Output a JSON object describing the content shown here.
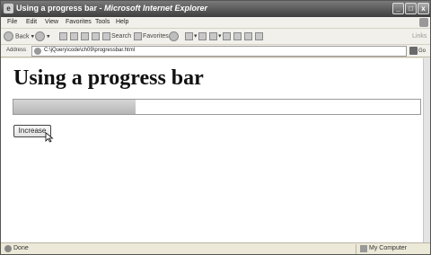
{
  "window": {
    "title_page": "Using a progress bar",
    "title_sep": " - ",
    "title_app": "Microsoft Internet Explorer",
    "minimize_glyph": "_",
    "maximize_glyph": "□",
    "close_glyph": "x",
    "app_icon_glyph": "e"
  },
  "menubar": {
    "items": [
      "File",
      "Edit",
      "View",
      "Favorites",
      "Tools",
      "Help"
    ]
  },
  "toolbar": {
    "back_label": "Back",
    "search_label": "Search",
    "favorites_label": "Favorites",
    "links_label": "Links",
    "icons": [
      "back-icon",
      "forward-icon",
      "stop-icon",
      "refresh-icon",
      "home-icon",
      "search-icon",
      "favorites-icon",
      "media-icon",
      "mail-icon",
      "print-icon",
      "edit-icon",
      "discuss-icon"
    ]
  },
  "addressbar": {
    "label": "Address",
    "value": "C:\\jQuery\\code\\ch09\\progressbar.html",
    "go_label": "Go",
    "dropdown_glyph": "▾"
  },
  "page": {
    "heading": "Using a progress bar",
    "progress_fraction": 0.3,
    "increase_label": "Increase"
  },
  "statusbar": {
    "status_text": "Done",
    "zone_text": "My Computer"
  },
  "colors": {
    "progress_fill": "#c4c4c4",
    "titlebar": "#4a4a4a"
  }
}
